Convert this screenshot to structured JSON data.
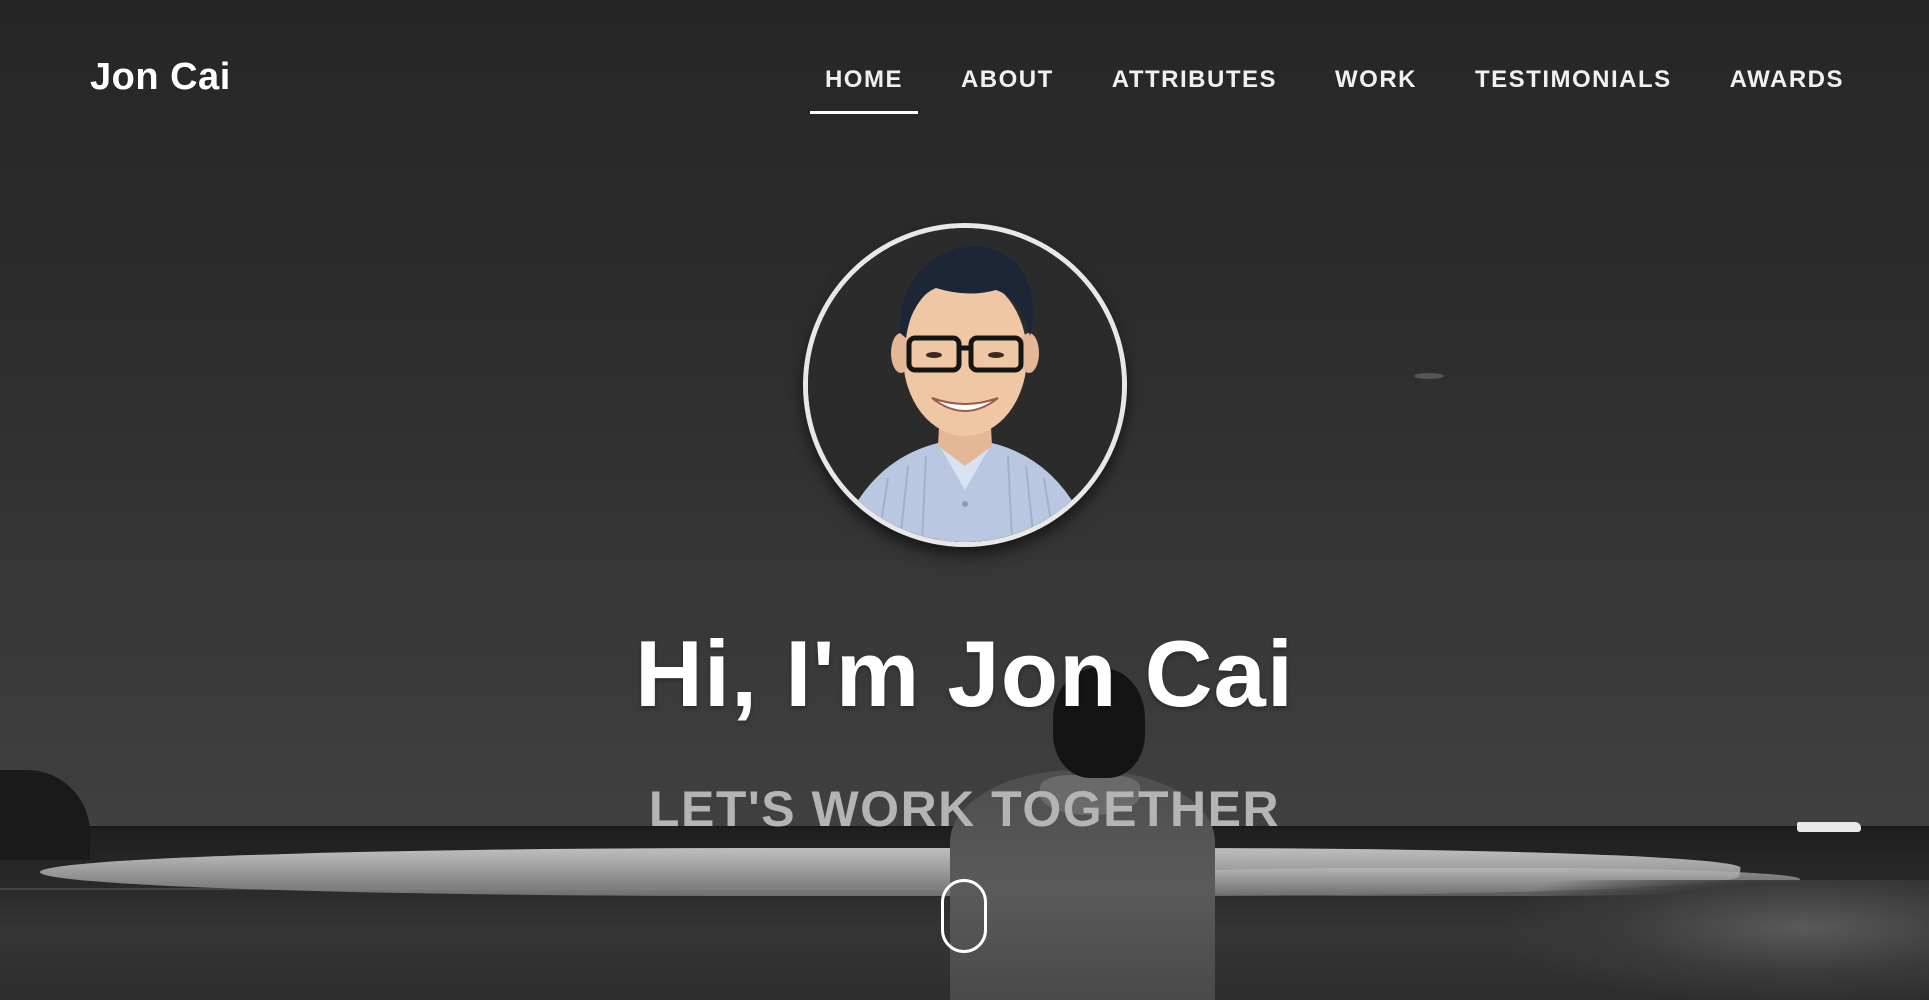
{
  "site": {
    "brand": "Jon Cai"
  },
  "nav": {
    "items": [
      {
        "label": "HOME",
        "active": true
      },
      {
        "label": "ABOUT",
        "active": false
      },
      {
        "label": "ATTRIBUTES",
        "active": false
      },
      {
        "label": "WORK",
        "active": false
      },
      {
        "label": "TESTIMONIALS",
        "active": false
      },
      {
        "label": "AWARDS",
        "active": false
      }
    ]
  },
  "hero": {
    "headline": "Hi, I'm Jon Cai",
    "subheadline": "LET'S WORK TOGETHER",
    "avatar_icon": "portrait-photo",
    "scroll_icon": "mouse-scroll-icon"
  },
  "colors": {
    "text_primary": "#ffffff",
    "text_muted": "#b4b4b4",
    "background": "#2a2a2a"
  }
}
